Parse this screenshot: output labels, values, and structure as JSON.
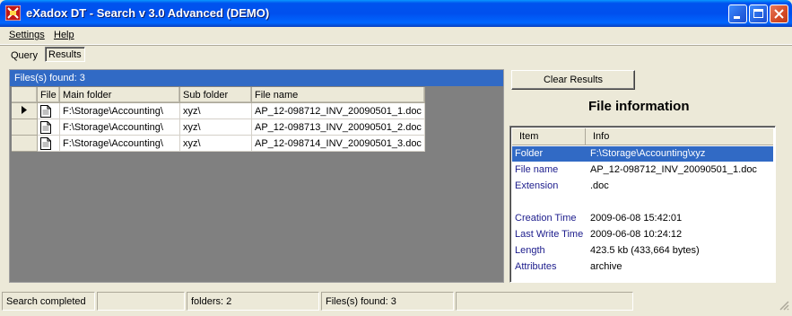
{
  "window": {
    "title": "eXadox DT - Search v 3.0 Advanced (DEMO)"
  },
  "menu": {
    "settings": "Settings",
    "help": "Help"
  },
  "tabs": {
    "query": "Query",
    "results": "Results",
    "selected": "Results"
  },
  "results": {
    "header": "Files(s) found: 3",
    "columns": [
      "File",
      "Main folder",
      "Sub folder",
      "File name"
    ],
    "rows": [
      {
        "main_folder": "F:\\Storage\\Accounting\\",
        "sub_folder": "xyz\\",
        "file_name": "AP_12-098712_INV_20090501_1.doc",
        "current": true
      },
      {
        "main_folder": "F:\\Storage\\Accounting\\",
        "sub_folder": "xyz\\",
        "file_name": "AP_12-098713_INV_20090501_2.doc",
        "current": false
      },
      {
        "main_folder": "F:\\Storage\\Accounting\\",
        "sub_folder": "xyz\\",
        "file_name": "AP_12-098714_INV_20090501_3.doc",
        "current": false
      }
    ]
  },
  "clear_button": "Clear Results",
  "file_info": {
    "title": "File information",
    "columns": [
      "Item",
      "Info"
    ],
    "rows": [
      {
        "item": "Folder",
        "info": "F:\\Storage\\Accounting\\xyz",
        "selected": true
      },
      {
        "item": "File name",
        "info": "AP_12-098712_INV_20090501_1.doc"
      },
      {
        "item": "Extension",
        "info": ".doc"
      },
      {
        "item": "",
        "info": ""
      },
      {
        "item": "Creation Time",
        "info": "2009-06-08 15:42:01"
      },
      {
        "item": "Last Write Time",
        "info": "2009-06-08 10:24:12"
      },
      {
        "item": "Length",
        "info": "423.5 kb (433,664 bytes)"
      },
      {
        "item": "Attributes",
        "info": "archive"
      }
    ]
  },
  "statusbar": {
    "status": "Search completed",
    "panel2": "",
    "folders": "folders: 2",
    "files": "Files(s) found: 3",
    "panel5": ""
  },
  "colors": {
    "selection": "#316ac5",
    "window_bg": "#ece9d8",
    "grid_bg": "#808080"
  }
}
